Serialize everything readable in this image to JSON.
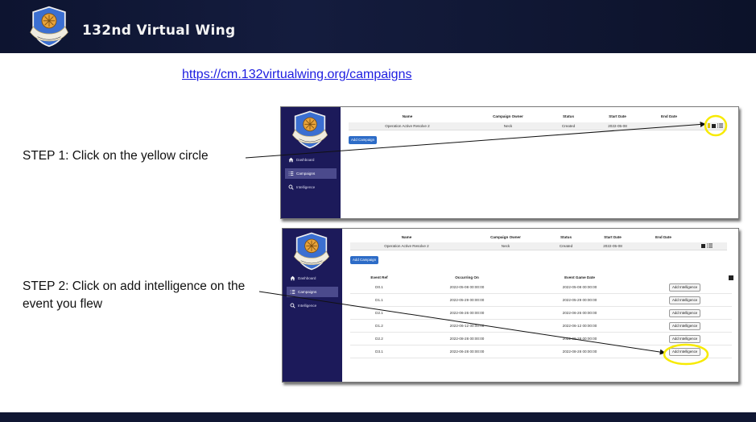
{
  "header": {
    "title": "132nd Virtual Wing",
    "logo_icon": "wing-crest-icon"
  },
  "link": {
    "url_text": "https://cm.132virtualwing.org/campaigns"
  },
  "steps": {
    "step1": "STEP 1: Click on the yellow circle",
    "step2": "STEP 2: Click on add intelligence on the event you flew"
  },
  "colors": {
    "banner": "#141c3e",
    "sidebar": "#1c1a5a",
    "accent_button": "#2d6cc7",
    "highlight": "#f7ea00"
  },
  "app": {
    "sidebar": [
      {
        "label": "Dashboard",
        "icon": "home-icon"
      },
      {
        "label": "Campaigns",
        "icon": "list-icon"
      },
      {
        "label": "Intelligence",
        "icon": "search-icon"
      }
    ],
    "campaign_columns": [
      "Name",
      "Campaign Owner",
      "Status",
      "Start Date",
      "End Date"
    ],
    "campaign_row": {
      "name": "Operation Active Resolve 2",
      "owner": "Neck",
      "status": "Created",
      "start_date": "2022-05-08",
      "end_date": ""
    },
    "add_campaign_label": "Add Campaign",
    "event_columns": [
      "Event Ref",
      "Occurring On",
      "Event Game Date"
    ],
    "events": [
      {
        "ref": "D0.1",
        "occurring_on": "2022-05-08 00:00:00",
        "game_date": "2022-05-08 00:00:00"
      },
      {
        "ref": "D1.1",
        "occurring_on": "2022-05-29 00:00:00",
        "game_date": "2022-05-29 00:00:00"
      },
      {
        "ref": "D2.1",
        "occurring_on": "2022-06-26 00:00:00",
        "game_date": "2022-06-26 00:00:00"
      },
      {
        "ref": "D1.2",
        "occurring_on": "2022-06-12 00:00:00",
        "game_date": "2022-06-12 00:00:00"
      },
      {
        "ref": "D2.2",
        "occurring_on": "2022-08-28 00:00:00",
        "game_date": "2022-08-28 00:00:00"
      },
      {
        "ref": "D3.1",
        "occurring_on": "2022-06-28 00:00:00",
        "game_date": "2022-08-28 00:00:00"
      }
    ],
    "add_intelligence_label": "Add Intelligence"
  }
}
